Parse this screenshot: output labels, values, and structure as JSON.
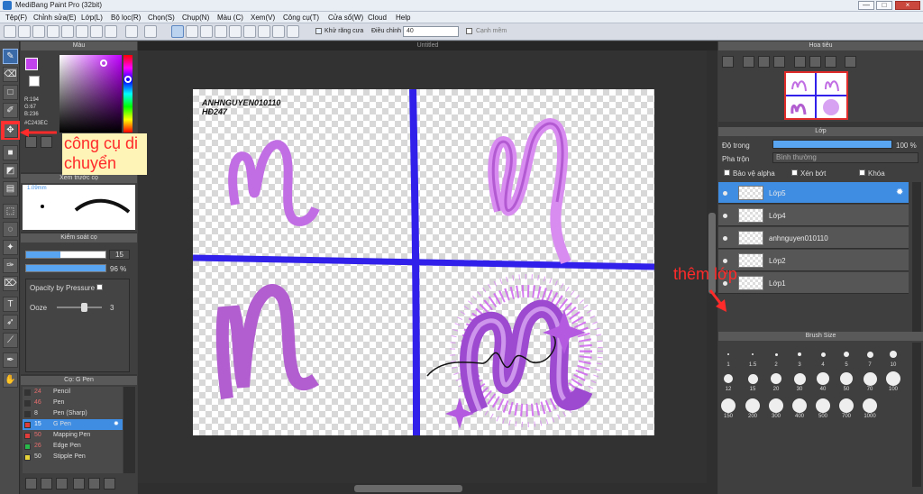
{
  "app": {
    "title": "MediBang Paint Pro (32bit)"
  },
  "window_controls": {
    "minimize": "—",
    "maximize": "□",
    "close": "×"
  },
  "menu": [
    "Tệp(F)",
    "Chỉnh sửa(E)",
    "Lớp(L)",
    "Bộ lọc(R)",
    "Chọn(S)",
    "Chụp(N)",
    "Màu (C)",
    "Xem(V)",
    "Công cụ(T)",
    "Cửa sổ(W)",
    "Cloud",
    "Help"
  ],
  "toolbar": {
    "antialias_label": "Khử răng cưa",
    "adjust_label": "Điều chỉnh",
    "adjust_value": "40",
    "smooth_label": "Cạnh mềm"
  },
  "colors": {
    "accent": "#3f8de3",
    "brush_purple": "#b25dd0",
    "blue_line": "#3020ea",
    "annotation": "#ff2a2a"
  },
  "color_panel": {
    "title": "Màu",
    "r": "R:194",
    "g": "G:67",
    "b": "B:236",
    "hex": "#C243EC"
  },
  "brush_preview": {
    "title": "Xem trước cọ",
    "size": "1.09mm"
  },
  "brush_control": {
    "title": "Kiểm soát cọ",
    "size_value": "15",
    "opacity_value": "96 %",
    "opacity_pressure_label": "Opacity by Pressure",
    "ooze_label": "Ooze",
    "ooze_value": "3"
  },
  "brush_list": {
    "title": "Cọ: G Pen",
    "items": [
      {
        "num": "24",
        "name": "Pencil",
        "color": "#333333"
      },
      {
        "num": "46",
        "name": "Pen",
        "color": "#333333"
      },
      {
        "num": "8",
        "name": "Pen (Sharp)",
        "color": "#333333"
      },
      {
        "num": "15",
        "name": "G Pen",
        "color": "#e03c3c"
      },
      {
        "num": "50",
        "name": "Mapping Pen",
        "color": "#e03c3c"
      },
      {
        "num": "26",
        "name": "Edge Pen",
        "color": "#29b94b"
      },
      {
        "num": "50",
        "name": "Stipple Pen",
        "color": "#e6d33a"
      }
    ]
  },
  "canvas": {
    "tab_title": "Untitled",
    "watermark_line1": "ANHNGUYEN010110",
    "watermark_line2": "HĐ247"
  },
  "navigator": {
    "title": "Hoa tiêu"
  },
  "layer_panel": {
    "title": "Lớp",
    "opacity_label": "Độ trong",
    "opacity_value": "100 %",
    "blend_label": "Pha trộn",
    "blend_value": "Bình thường",
    "protect_alpha": "Bảo vệ alpha",
    "clipping": "Xén bớt",
    "lock": "Khóa",
    "layers": [
      "Lớp5",
      "Lớp4",
      "anhnguyen010110",
      "Lớp2",
      "Lớp1"
    ]
  },
  "brush_size": {
    "title": "Brush Size",
    "sizes": [
      "1",
      "1.5",
      "2",
      "3",
      "4",
      "5",
      "7",
      "10",
      "12",
      "15",
      "20",
      "30",
      "40",
      "50",
      "70",
      "100",
      "150",
      "200",
      "300",
      "400",
      "500",
      "700",
      "1000"
    ]
  },
  "annotations": {
    "move_tool": "công cụ di chuyển",
    "add_layer": "thêm lớp"
  }
}
